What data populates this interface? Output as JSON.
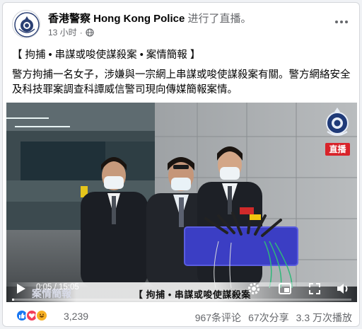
{
  "post": {
    "page_name": "香港警察 Hong Kong Police",
    "action": "进行了直播。",
    "time": "13 小时",
    "separator": "·",
    "title_line": "【 拘捕 • 串謀或唆使謀殺案 • 案情簡報 】",
    "body": "警方拘捕一名女子，涉嫌與一宗網上串謀或唆使謀殺案有關。警方網絡安全及科技罪案調查科譚威信警司現向傳媒簡報案情。"
  },
  "video": {
    "live_badge": "直播",
    "ticker_left": "案情簡報",
    "ticker_right": "【 拘捕 • 串謀或唆使謀殺案",
    "time_current": "0:05",
    "time_total": "15:05",
    "time_sep": " / ",
    "progress_fraction": 0.0055,
    "icons": [
      "play-icon",
      "settings-icon",
      "pip-icon",
      "fullscreen-icon",
      "volume-icon"
    ]
  },
  "footer": {
    "reaction_count": "3,239",
    "reactions": [
      "like-icon",
      "love-icon",
      "haha-icon"
    ],
    "comments": "967条评论",
    "shares": "67次分享",
    "plays": "3.3 万次播放"
  },
  "colors": {
    "live_red": "#d8232a",
    "like_blue": "#1877f2",
    "love_red": "#f33e58",
    "meta_gray": "#65676b"
  }
}
